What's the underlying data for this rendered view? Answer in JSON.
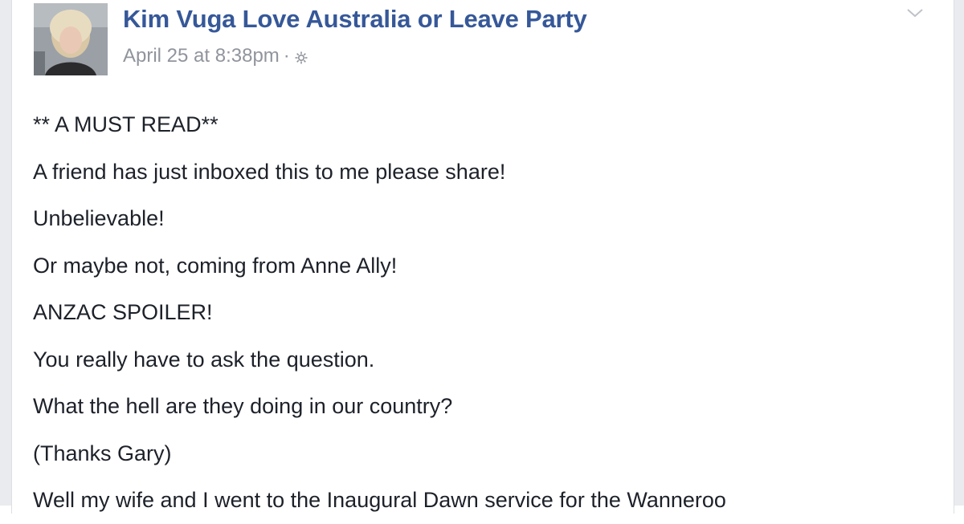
{
  "post": {
    "author_name": "Kim Vuga Love Australia or Leave Party",
    "timestamp": "April 25 at 8:38pm",
    "separator": "·",
    "audience_icon": "gear-icon",
    "menu_icon": "chevron-down-icon",
    "lines": [
      "** A MUST READ**",
      "A friend has just inboxed this to me please share!",
      "Unbelievable!",
      "Or maybe not, coming from Anne Ally!",
      "ANZAC SPOILER!",
      "You really have to ask the question.",
      "What the hell are they doing in our country?",
      "(Thanks Gary)",
      "Well my wife and I went to the Inaugural Dawn service for the Wanneroo"
    ]
  },
  "colors": {
    "author_link": "#365899",
    "meta_text": "#90949c",
    "body_text": "#1d2129",
    "page_background": "#e9ebee",
    "card_background": "#ffffff"
  }
}
